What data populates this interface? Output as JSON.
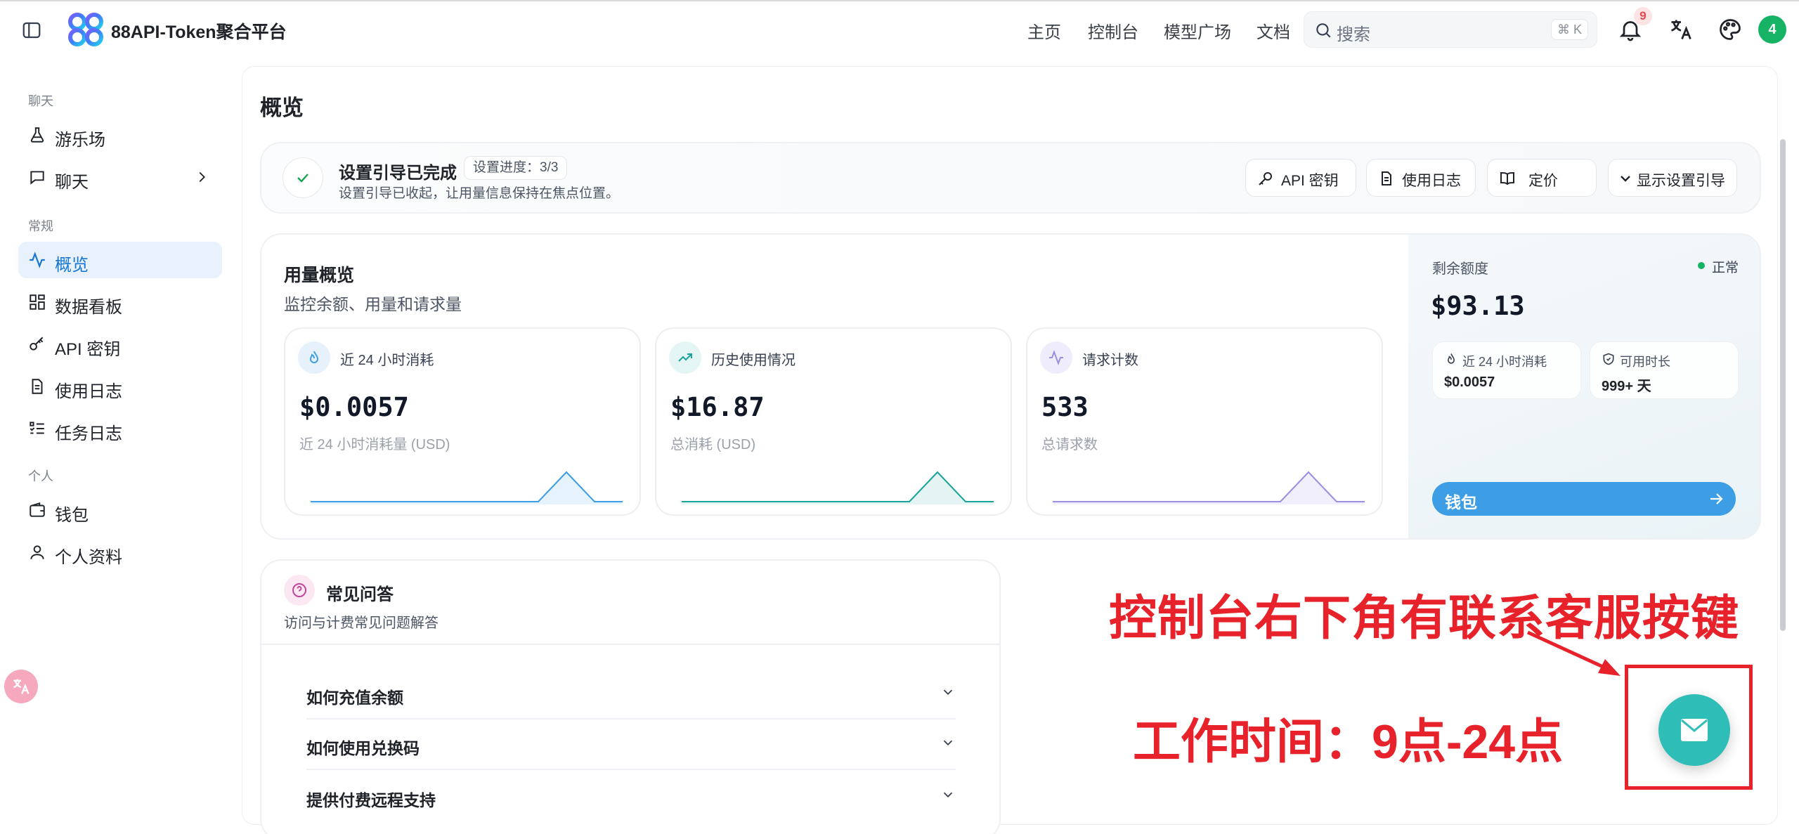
{
  "app": {
    "brand": "88API-Token聚合平台"
  },
  "topnav": {
    "items": [
      "主页",
      "控制台",
      "模型广场",
      "文档"
    ],
    "search_placeholder": "搜索",
    "search_shortcut": "⌘ K",
    "notification_count": "9",
    "avatar_text": "4"
  },
  "sidebar": {
    "sections": {
      "chat": "聊天",
      "general": "常规",
      "personal": "个人"
    },
    "items": [
      {
        "label": "游乐场",
        "icon": "flask-icon"
      },
      {
        "label": "聊天",
        "icon": "chat-icon"
      },
      {
        "label": "概览",
        "icon": "activity-icon",
        "active": true
      },
      {
        "label": "数据看板",
        "icon": "dashboard-icon"
      },
      {
        "label": "API 密钥",
        "icon": "key-icon"
      },
      {
        "label": "使用日志",
        "icon": "document-icon"
      },
      {
        "label": "任务日志",
        "icon": "list-check-icon"
      },
      {
        "label": "钱包",
        "icon": "wallet-icon"
      },
      {
        "label": "个人资料",
        "icon": "user-icon"
      }
    ]
  },
  "page": {
    "title": "概览"
  },
  "guide": {
    "title": "设置引导已完成",
    "progress": "设置进度：3/3",
    "desc": "设置引导已收起，让用量信息保持在焦点位置。",
    "buttons": [
      "API 密钥",
      "使用日志",
      "定价",
      "显示设置引导"
    ]
  },
  "usage": {
    "title": "用量概览",
    "subtitle": "监控余额、用量和请求量",
    "stats": [
      {
        "title": "近 24 小时消耗",
        "value": "$0.0057",
        "sub": "近 24 小时消耗量 (USD)",
        "color": "#3d9ee5"
      },
      {
        "title": "历史使用情况",
        "value": "$16.87",
        "sub": "总消耗 (USD)",
        "color": "#1aa39a"
      },
      {
        "title": "请求计数",
        "value": "533",
        "sub": "总请求数",
        "color": "#9b8fe0"
      }
    ],
    "balance": {
      "label": "剩余额度",
      "status": "正常",
      "value": "$93.13",
      "mini": [
        {
          "title": "近 24 小时消耗",
          "value": "$0.0057"
        },
        {
          "title": "可用时长",
          "value": "999+ 天"
        }
      ],
      "wallet_button": "钱包"
    }
  },
  "faq": {
    "title": "常见问答",
    "subtitle": "访问与计费常见问题解答",
    "questions": [
      "如何充值余额",
      "如何使用兑换码",
      "提供付费远程支持"
    ]
  },
  "annotation": {
    "line1": "控制台右下角有联系客服按键",
    "line2": "工作时间：9点-24点",
    "color": "#e8222a"
  },
  "colors": {
    "accent": "#1677d2",
    "contact": "#2fbdb8",
    "status_ok": "#16b364"
  }
}
